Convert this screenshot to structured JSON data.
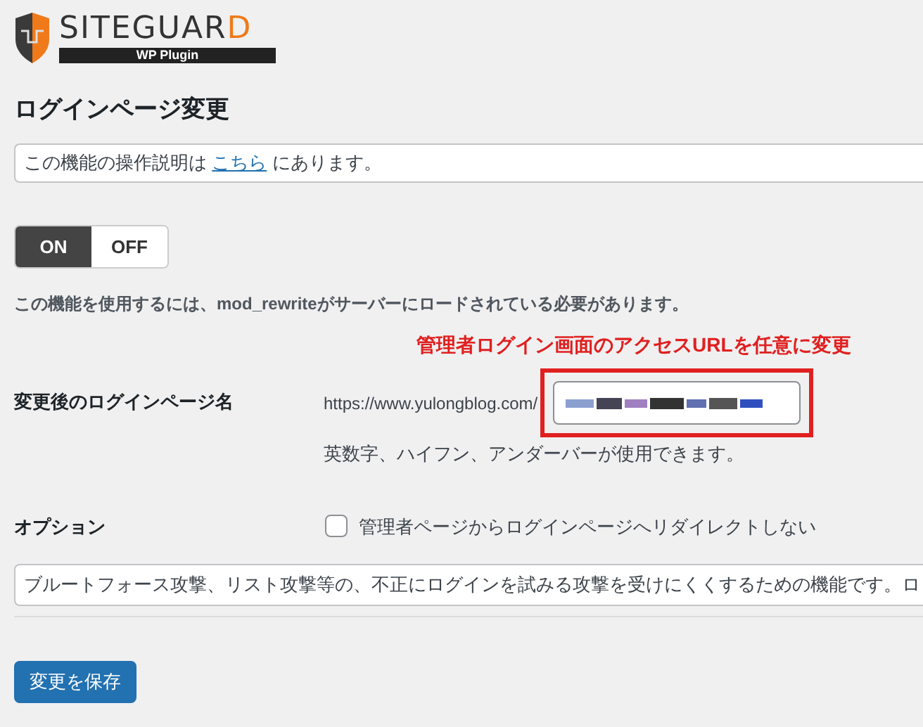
{
  "logo": {
    "name": "SITEGUAR",
    "name_accent": "D",
    "subtitle": "WP Plugin"
  },
  "title": "ログインページ変更",
  "notice": {
    "before": "この機能の操作説明は",
    "link": "こちら",
    "after": "にあります。"
  },
  "toggle": [
    {
      "label": "ON",
      "selected": true
    },
    {
      "label": "OFF",
      "selected": false
    }
  ],
  "requirement": "この機能を使用するには、mod_rewriteがサーバーにロードされている必要があります。",
  "annotation": "管理者ログイン画面のアクセスURLを任意に変更",
  "login_page": {
    "label": "変更後のログインページ名",
    "prefix": "https://www.yulongblog.com/",
    "hint": "英数字、ハイフン、アンダーバーが使用できます。"
  },
  "option": {
    "label": "オプション",
    "checkbox_label": "管理者ページからログインページへリダイレクトしない",
    "checked": false
  },
  "description": "ブルートフォース攻撃、リスト攻撃等の、不正にログインを試みる攻撃を受けにくくするための機能です。ロ",
  "save_button": "変更を保存"
}
